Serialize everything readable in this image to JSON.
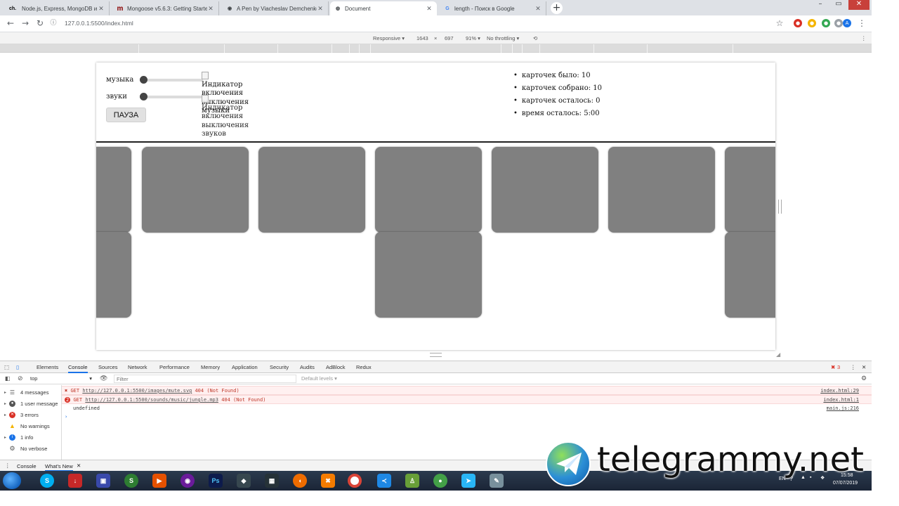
{
  "browser": {
    "tabs": [
      {
        "favicon": "ch.",
        "title": "Node.js, Express, MongoDB и бе",
        "favicon_color": "#000000"
      },
      {
        "favicon": "m",
        "title": "Mongoose v5.6.3: Getting Starte",
        "favicon_color": "#880000"
      },
      {
        "favicon": "◉",
        "title": "A Pen by Viacheslav Demchenko",
        "favicon_color": "#333333"
      },
      {
        "favicon": "◍",
        "title": "Document",
        "favicon_color": "#5f6368"
      },
      {
        "favicon": "G",
        "title": "length - Поиск в Google",
        "favicon_color": "#4285f4"
      }
    ],
    "new_tab": "+",
    "url": "127.0.0.1:5500/index.html"
  },
  "device_toolbar": {
    "mode": "Responsive ▾",
    "width": "1643",
    "times": "×",
    "height": "697",
    "zoom": "91% ▾",
    "throttling": "No throttling ▾"
  },
  "page": {
    "music_label": "музыка",
    "sounds_label": "звуки",
    "music_level": 0,
    "sounds_level": 0,
    "pause_label": "ПАУЗА",
    "music_img_alt": [
      "Индикатор",
      "‍‍‍‍‍‍‍‍‍‍‍‍‍включения",
      "выключения",
      "музыки"
    ],
    "sound_img_alt": [
      "Индикатор",
      "включения",
      "выключения",
      "звуков"
    ],
    "stats": [
      "карточек было: 10",
      "карточек собрано: 10",
      "карточек осталось: 0",
      "время осталось: 5:00"
    ],
    "card_color": "#808080"
  },
  "devtools": {
    "tabs": [
      "Elements",
      "Console",
      "Sources",
      "Network",
      "Performance",
      "Memory",
      "Application",
      "Security",
      "Audits",
      "AdBlock",
      "Redux"
    ],
    "active_tab": "Console",
    "error_count": "3",
    "context": "top",
    "filter_placeholder": "Filter",
    "levels": "Default levels ▾",
    "sidebar": [
      {
        "label": "4 messages",
        "icon": "list-icon"
      },
      {
        "label": "1 user message",
        "icon": "user-icon"
      },
      {
        "label": "3 errors",
        "icon": "error-icon"
      },
      {
        "label": "No warnings",
        "icon": "warning-icon"
      },
      {
        "label": "1 info",
        "icon": "info-icon"
      },
      {
        "label": "No verbose",
        "icon": "gear-icon"
      }
    ],
    "console": [
      {
        "prefix": "GET",
        "url": "http://127.0.0.1:5500/images/mute.svg",
        "status": "404 (Not Found)",
        "source": "index.html:29",
        "badge": "✖"
      },
      {
        "prefix": "GET",
        "url": "http://127.0.0.1:5500/sounds/music/jungle.mp3",
        "status": "404 (Not Found)",
        "source": "index.html:1",
        "badge": "2"
      },
      {
        "text": "undefined",
        "source": "main.js:216"
      }
    ],
    "prompt": "›",
    "drawer_tabs": [
      "Console",
      "What's New"
    ]
  },
  "taskbar": {
    "lang": "EN",
    "time": "15:58",
    "date": "07/07/2019"
  },
  "watermark": {
    "text": "telegrammy.net"
  }
}
